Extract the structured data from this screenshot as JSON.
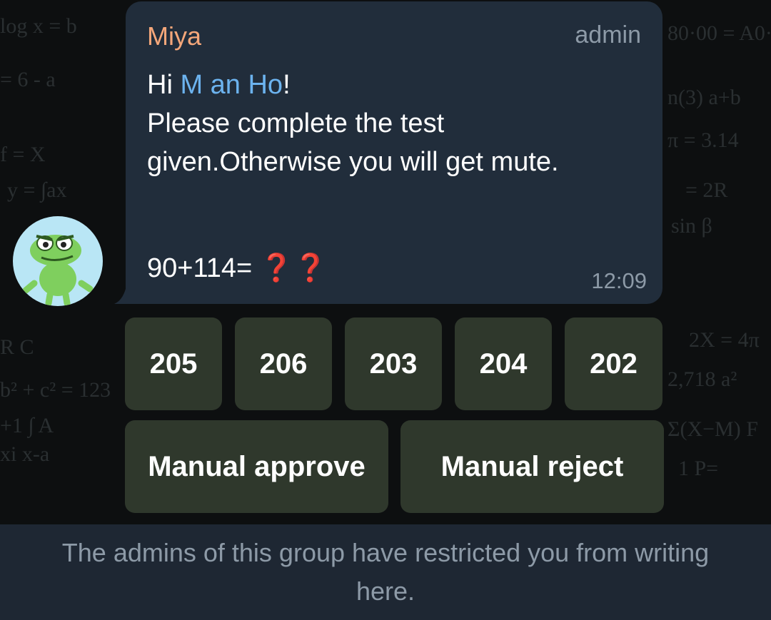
{
  "message": {
    "sender": "Miya",
    "role": "admin",
    "greeting_prefix": "Hi ",
    "mention": "M an Ho",
    "greeting_suffix": "!",
    "body": "Please complete the test given.Otherwise you will get mute.",
    "question": "90+114=",
    "question_marks": "❓❓",
    "time": "12:09",
    "sender_color": "#f5a77a",
    "mention_color": "#6cb3ef"
  },
  "answers": [
    "205",
    "206",
    "203",
    "204",
    "202"
  ],
  "actions": {
    "approve_label": "Manual approve",
    "reject_label": "Manual reject"
  },
  "footer": {
    "restriction_text": "The admins of this group have restricted you from writing here."
  },
  "avatar": {
    "icon": "crocodile-sticker-icon"
  }
}
